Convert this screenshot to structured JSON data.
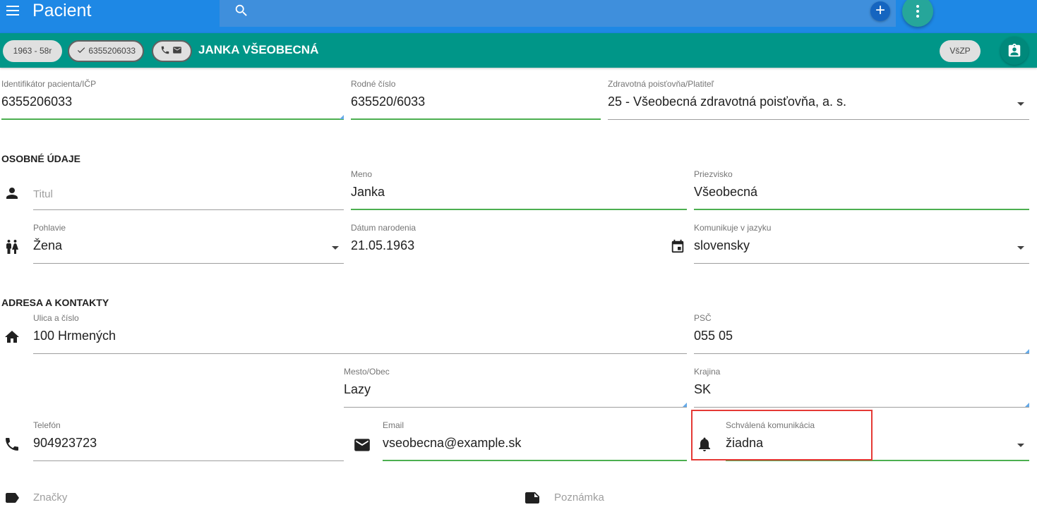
{
  "appbar": {
    "title": "Pacient",
    "menu_icon": "menu-icon",
    "search_icon": "search-icon",
    "add_icon": "plus-icon",
    "more_icon": "more-vertical-icon",
    "color": "#1e88e5"
  },
  "patient_bar": {
    "birth_chip": "1963 - 58r",
    "id_chip": "6355206033",
    "patient_name": "JANKA VŠEOBECNÁ",
    "insurer_chip": "VšZP",
    "color": "#009688"
  },
  "fields": {
    "icp": {
      "label": "Identifikátor pacienta/IČP",
      "value": "6355206033"
    },
    "rodne_cislo": {
      "label": "Rodné číslo",
      "value": "635520/6033"
    },
    "poistovna": {
      "label": "Zdravotná poisťovňa/Platiteľ",
      "value": "25 - Všeobecná zdravotná poisťovňa, a. s."
    },
    "titul": {
      "label": "",
      "placeholder": "Titul"
    },
    "meno": {
      "label": "Meno",
      "value": "Janka"
    },
    "priezvisko": {
      "label": "Priezvisko",
      "value": "Všeobecná"
    },
    "pohlavie": {
      "label": "Pohlavie",
      "value": "Žena"
    },
    "datum_narodenia": {
      "label": "Dátum narodenia",
      "value": "21.05.1963"
    },
    "jazyk": {
      "label": "Komunikuje v jazyku",
      "value": "slovensky"
    },
    "ulica": {
      "label": "Ulica a číslo",
      "value": "100 Hrmených"
    },
    "psc": {
      "label": "PSČ",
      "value": "055 05"
    },
    "mesto": {
      "label": "Mesto/Obec",
      "value": "Lazy"
    },
    "krajina": {
      "label": "Krajina",
      "value": "SK"
    },
    "telefon": {
      "label": "Telefón",
      "value": "904923723"
    },
    "email": {
      "label": "Email",
      "value": "vseobecna@example.sk"
    },
    "komunikacia": {
      "label": "Schválená komunikácia",
      "value": "žiadna"
    }
  },
  "sections": {
    "osobne": "OSOBNÉ ÚDAJE",
    "adresa": "ADRESA A KONTAKTY"
  },
  "bottom": {
    "tags": "Značky",
    "note": "Poznámka"
  },
  "accent_colors": {
    "focus_underline": "#4caf50",
    "highlight_box": "#e53935"
  }
}
